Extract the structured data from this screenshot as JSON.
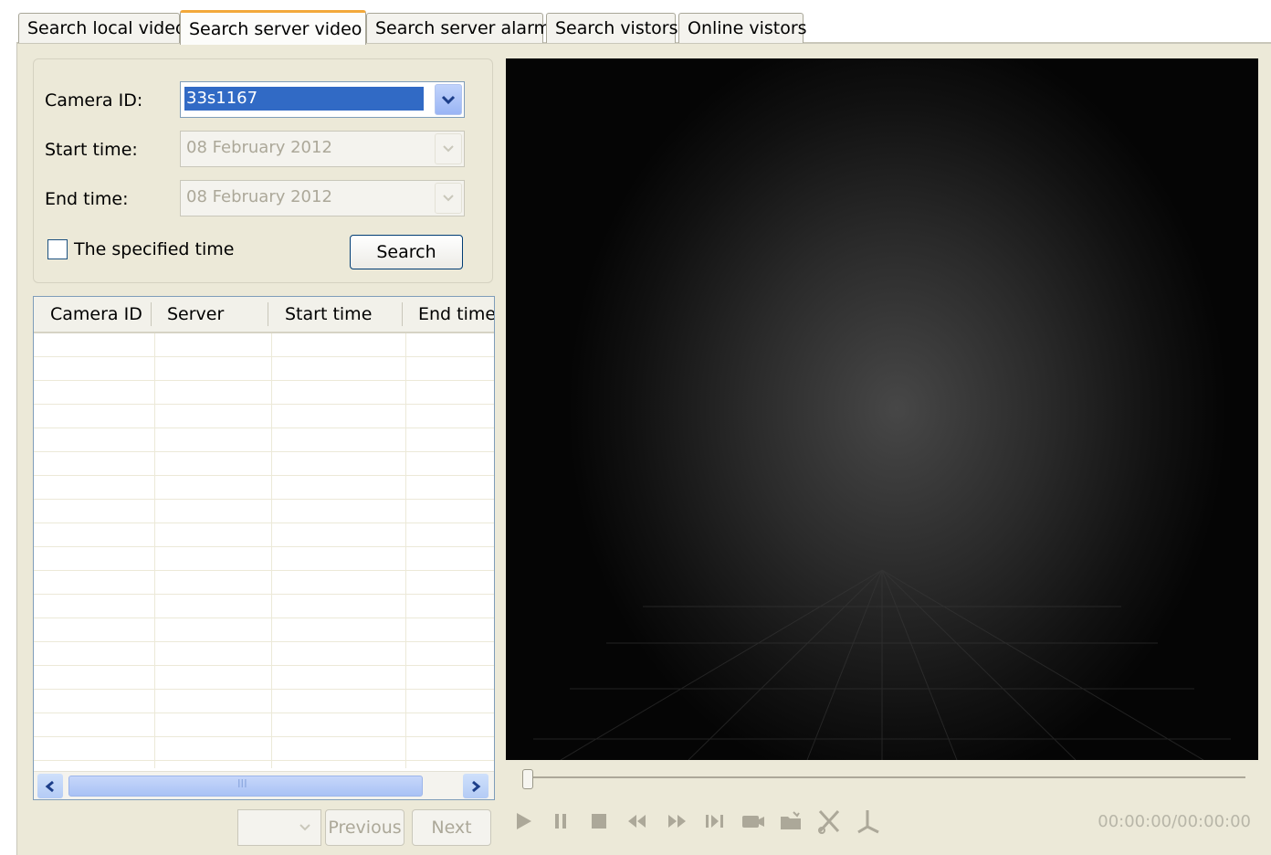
{
  "tabs": [
    {
      "label": "Search local video",
      "active": false
    },
    {
      "label": "Search server video",
      "active": true
    },
    {
      "label": "Search server alarm",
      "active": false
    },
    {
      "label": "Search vistors",
      "active": false
    },
    {
      "label": "Online vistors",
      "active": false
    }
  ],
  "search": {
    "camera_id_label": "Camera ID:",
    "camera_id_value": "33s1167",
    "start_time_label": "Start time:",
    "start_time_value": "08  February  2012",
    "end_time_label": "End time:",
    "end_time_value": "08  February  2012",
    "specified_time_label": "The specified time",
    "specified_time_checked": false,
    "search_button": "Search"
  },
  "results": {
    "columns": [
      "Camera ID",
      "Server",
      "Start time",
      "End time"
    ],
    "rows": [],
    "scroll_thumb_label": "III"
  },
  "paging": {
    "previous": "Previous",
    "next": "Next",
    "page_value": ""
  },
  "player": {
    "timecode": "00:00:00/00:00:00",
    "controls": [
      "play-icon",
      "pause-icon",
      "stop-icon",
      "rewind-icon",
      "fast-forward-icon",
      "step-forward-icon",
      "record-icon",
      "folder-icon",
      "clip-start-icon",
      "clip-end-icon"
    ]
  },
  "colors": {
    "active_tab_accent": "#f2a83a",
    "selection": "#316ac5",
    "panel": "#ece9d8"
  }
}
